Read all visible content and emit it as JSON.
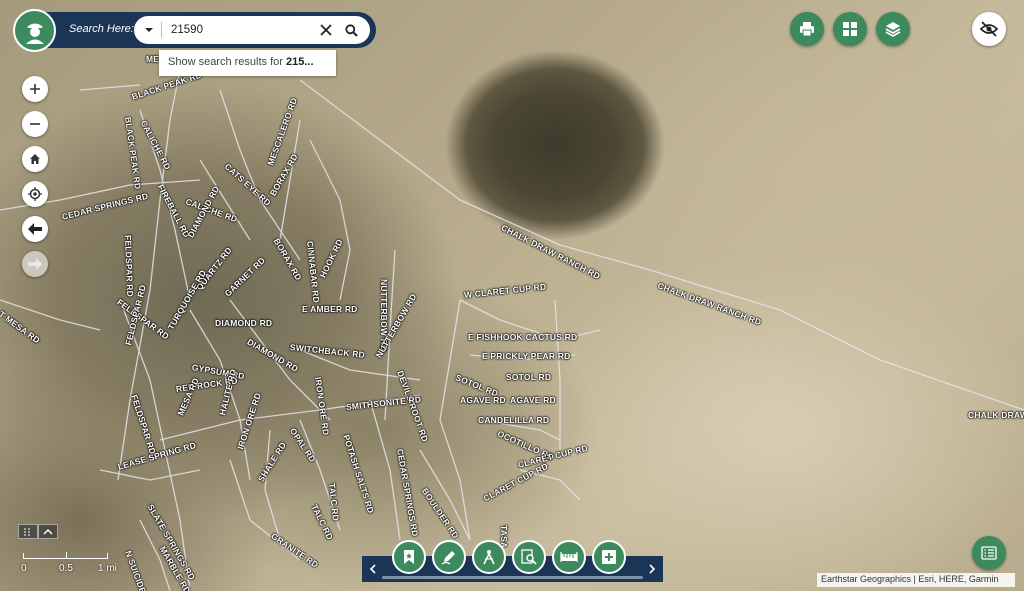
{
  "search": {
    "label": "Search Here:",
    "value": "21590",
    "suggestion_prefix": "Show search results for ",
    "suggestion_term": "215..."
  },
  "roads": [
    {
      "name": "BLACK PEAK RD"
    },
    {
      "name": "BLACK PEAK RD"
    },
    {
      "name": "CALICHE RD"
    },
    {
      "name": "CATS EYE RD"
    },
    {
      "name": "MESCALERO RD"
    },
    {
      "name": "CEDAR SPRINGS RD"
    },
    {
      "name": "FIREBALL RD"
    },
    {
      "name": "CALICHE RD"
    },
    {
      "name": "BORAX RD"
    },
    {
      "name": "BORAX RD"
    },
    {
      "name": "CINNABAR RD"
    },
    {
      "name": "FELDSPAR RD"
    },
    {
      "name": "DIAMOND RD"
    },
    {
      "name": "QUARTZ RD"
    },
    {
      "name": "GARNET RD"
    },
    {
      "name": "HOOK RD"
    },
    {
      "name": "FELDSPAR RD"
    },
    {
      "name": "TURQUOISE RD"
    },
    {
      "name": "DIAMOND RD"
    },
    {
      "name": "E AMBER RD"
    },
    {
      "name": "NUTTERBOW RD"
    },
    {
      "name": "W CLARET CUP RD"
    },
    {
      "name": "CHALK DRAW RANCH RD"
    },
    {
      "name": "CHALK DRAW RANCH RD"
    },
    {
      "name": "DIAMOND RD"
    },
    {
      "name": "SWITCHBACK RD"
    },
    {
      "name": "E FISHHOOK CACTUS RD"
    },
    {
      "name": "E PRICKLY PEAR RD"
    },
    {
      "name": "FELDSPAR RD"
    },
    {
      "name": "GYPSUM RD"
    },
    {
      "name": "NUTTERBOW RD"
    },
    {
      "name": "DEVILS ROOT RD"
    },
    {
      "name": "SOTOL RD"
    },
    {
      "name": "SOTOL RD"
    },
    {
      "name": "RED ROCK RD"
    },
    {
      "name": "IRON ORE RD"
    },
    {
      "name": "AGAVE RD"
    },
    {
      "name": "AGAVE RD"
    },
    {
      "name": "FELDSPAR RD"
    },
    {
      "name": "MESA RD"
    },
    {
      "name": "HALITE RD"
    },
    {
      "name": "SMITHSONITE RD"
    },
    {
      "name": "CANDELILLA RD"
    },
    {
      "name": "OCOTILLO RD"
    },
    {
      "name": "OPAL RD"
    },
    {
      "name": "POTASH SALTS RD"
    },
    {
      "name": "CEDAR SPRINGS RD"
    },
    {
      "name": "IRON ORE RD"
    },
    {
      "name": "LEASE SPRING RD"
    },
    {
      "name": "CLARET CUP RD"
    },
    {
      "name": "CLARET CUP RD"
    },
    {
      "name": "SHALE RD"
    },
    {
      "name": "TALC RD"
    },
    {
      "name": "BOULDER RD"
    },
    {
      "name": "SLATE SPRINGS RD"
    },
    {
      "name": "TALC RD"
    },
    {
      "name": "GRANITE RD"
    },
    {
      "name": "MARBLE RD"
    },
    {
      "name": "N SUICIDE RD"
    },
    {
      "name": "T MESA RD"
    },
    {
      "name": "CHALK DRAW RD"
    },
    {
      "name": "ME"
    },
    {
      "name": "TASA"
    }
  ],
  "scale": {
    "labels": [
      "0",
      "0.5",
      "1 mi"
    ]
  },
  "attribution": "Earthstar Geographics | Esri, HERE, Garmin",
  "icons": {
    "logo": "ranger-avatar-icon",
    "zoom_in": "plus-icon",
    "zoom_out": "minus-icon",
    "home": "home-icon",
    "locate": "crosshair-icon",
    "back": "arrow-left-icon",
    "forward": "arrow-right-icon",
    "print": "printer-icon",
    "basemap": "grid-icon",
    "layers": "layers-icon",
    "visibility": "eye-off-icon",
    "legend": "list-icon",
    "bookmark": "bookmark-icon",
    "draw": "pencil-icon",
    "measure": "compass-icon",
    "query": "magnify-doc-icon",
    "measure_distance": "ruler-icon",
    "add": "add-box-icon"
  },
  "colors": {
    "navy": "#1b3557",
    "green": "#3d8a5e"
  }
}
